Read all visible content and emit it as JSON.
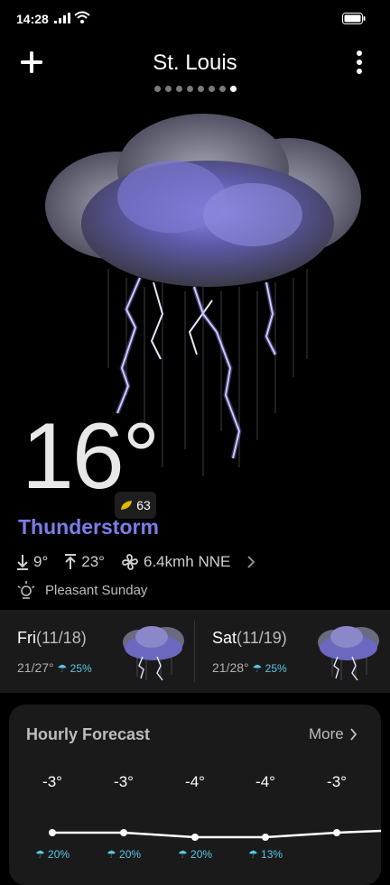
{
  "status": {
    "time": "14:28"
  },
  "header": {
    "city": "St. Louis",
    "page_dots": 8,
    "active_dot": 7
  },
  "current": {
    "temperature": "16°",
    "aqi": "63",
    "condition": "Thunderstorm",
    "low": "9°",
    "high": "23°",
    "wind": "6.4kmh NNE",
    "advice": "Pleasant Sunday"
  },
  "daily": [
    {
      "day": "Fri",
      "date": "(11/18)",
      "range": "21/27°",
      "precip": "25%"
    },
    {
      "day": "Sat",
      "date": "(11/19)",
      "range": "21/28°",
      "precip": "25%"
    }
  ],
  "hourly": {
    "title": "Hourly Forecast",
    "more_label": "More",
    "temps": [
      "-3°",
      "-3°",
      "-4°",
      "-4°",
      "-3°"
    ],
    "temp_values": [
      -3,
      -3,
      -4,
      -4,
      -3
    ],
    "precip": [
      "20%",
      "20%",
      "20%",
      "13%",
      ""
    ]
  },
  "colors": {
    "condition": "#7b7ee6",
    "precip": "#5ac8e6",
    "card": "#1a1a1a"
  }
}
